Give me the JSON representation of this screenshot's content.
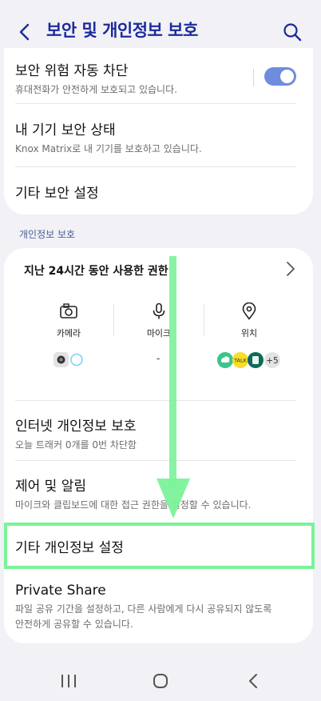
{
  "header": {
    "title": "보안 및 개인정보 보호",
    "back_icon": "chevron-left-icon",
    "search_icon": "search-icon"
  },
  "security": {
    "items": [
      {
        "title": "보안 위험 자동 차단",
        "subtitle": "휴대전화가 안전하게 보호되고 있습니다.",
        "toggle_on": true
      },
      {
        "title": "내 기기 보안 상태",
        "subtitle": "Knox Matrix로 내 기기를 보호하고 있습니다."
      },
      {
        "title": "기타 보안 설정"
      }
    ]
  },
  "privacy": {
    "section_label": "개인정보 보호",
    "permissions": {
      "title": "지난 24시간 동안 사용한 권한",
      "columns": [
        {
          "label": "카메라",
          "icon": "camera-icon"
        },
        {
          "label": "마이크",
          "icon": "microphone-icon",
          "apps_text": "-"
        },
        {
          "label": "위치",
          "icon": "location-pin-icon",
          "more_count": "+5"
        }
      ]
    },
    "items": [
      {
        "title": "인터넷 개인정보 보호",
        "subtitle": "오늘 트래커 0개를 0번 차단함"
      },
      {
        "title": "제어 및 알림",
        "subtitle": "마이크와 클립보드에 대한 접근 권한을 설정할 수 있습니다."
      },
      {
        "title": "기타 개인정보 설정"
      },
      {
        "title": "Private Share",
        "subtitle_line1": "파일 공유 기간을 설정하고, 다른 사람에게 다시 공유되지 않도록",
        "subtitle_line2": "안전하게 공유할 수 있습니다."
      }
    ]
  },
  "colors": {
    "accent": "#1b2a9c",
    "toggle": "#6f8ddf",
    "annotation": "#7cf29a",
    "background": "#f1f1f6"
  },
  "navbar": {
    "recents_icon": "recents-icon",
    "home_icon": "home-icon",
    "back_icon": "back-nav-icon"
  }
}
